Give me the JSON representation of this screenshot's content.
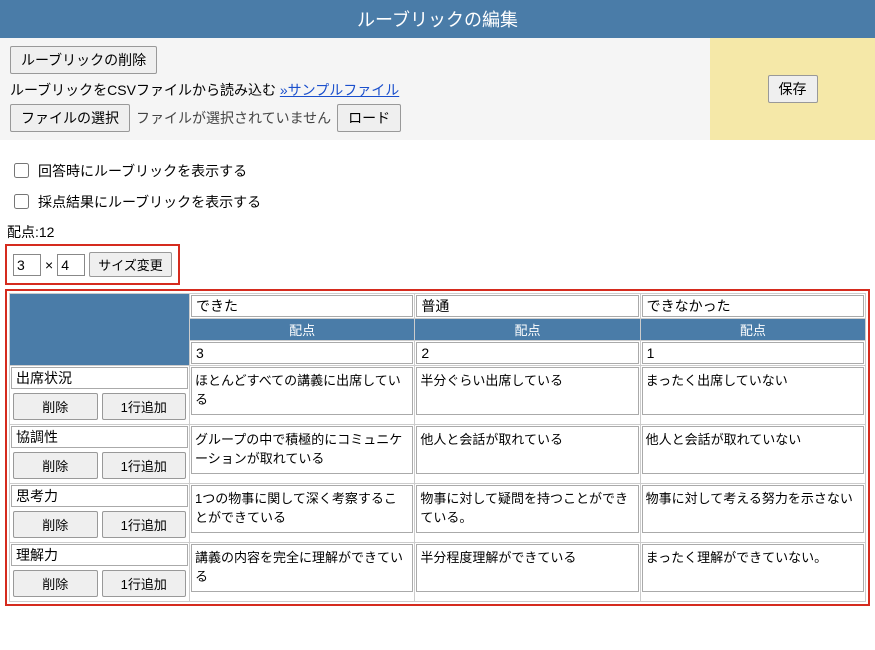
{
  "header": {
    "title": "ルーブリックの編集"
  },
  "toolbar": {
    "delete_rubric": "ルーブリックの削除",
    "save": "保存"
  },
  "csv": {
    "prefix": "ルーブリックをCSVファイルから読み込む",
    "sample_link": "»サンプルファイル",
    "choose_file": "ファイルの選択",
    "no_file": "ファイルが選択されていません",
    "load": "ロード"
  },
  "options": {
    "show_on_answer": "回答時にルーブリックを表示する",
    "show_on_grade": "採点結果にルーブリックを表示する"
  },
  "score": {
    "label": "配点:12",
    "rows": "3",
    "cols": "4",
    "times": "×",
    "resize": "サイズ変更",
    "col_header": "配点"
  },
  "row_buttons": {
    "delete": "削除",
    "add_row": "1行追加"
  },
  "levels": [
    {
      "name": "できた",
      "points": "3"
    },
    {
      "name": "普通",
      "points": "2"
    },
    {
      "name": "できなかった",
      "points": "1"
    }
  ],
  "criteria": [
    {
      "name": "出席状況",
      "cells": [
        "ほとんどすべての講義に出席している",
        "半分ぐらい出席している",
        "まったく出席していない"
      ]
    },
    {
      "name": "協調性",
      "cells": [
        "グループの中で積極的にコミュニケーションが取れている",
        "他人と会話が取れている",
        "他人と会話が取れていない"
      ]
    },
    {
      "name": "思考力",
      "cells": [
        "1つの物事に関して深く考察することができている",
        "物事に対して疑問を持つことができている。",
        "物事に対して考える努力を示さない"
      ]
    },
    {
      "name": "理解力",
      "cells": [
        "講義の内容を完全に理解ができている",
        "半分程度理解ができている",
        "まったく理解ができていない。"
      ]
    }
  ]
}
